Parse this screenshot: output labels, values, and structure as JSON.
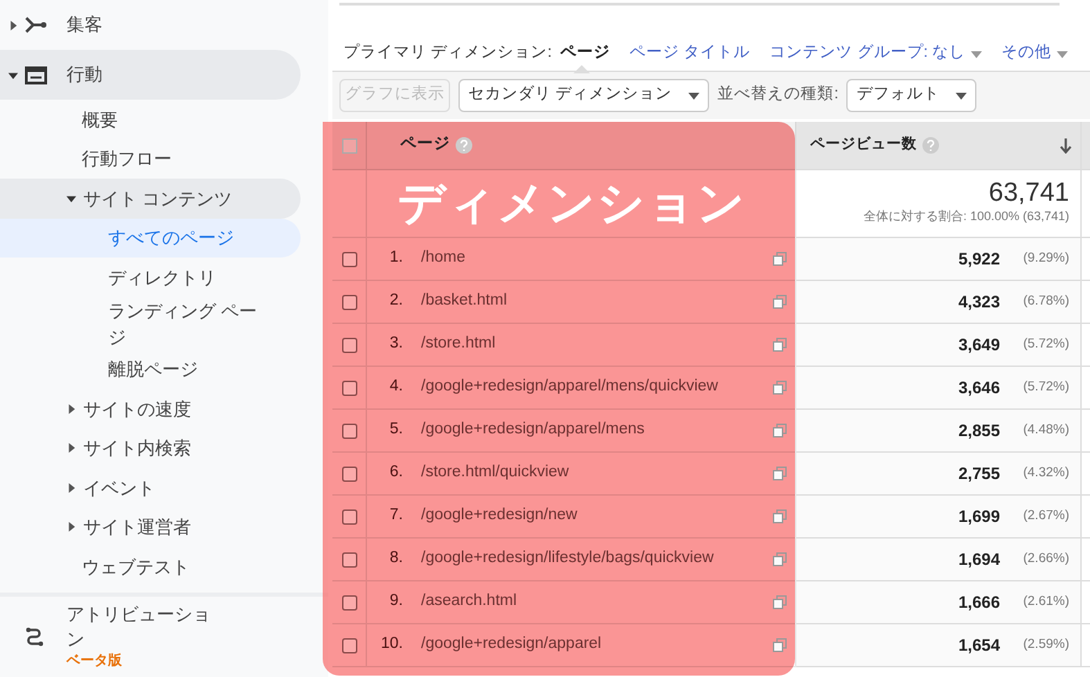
{
  "sidebar": {
    "items": [
      {
        "label": "集客",
        "expanded": false
      },
      {
        "label": "行動",
        "expanded": true,
        "children": [
          {
            "label": "概要"
          },
          {
            "label": "行動フロー"
          },
          {
            "label": "サイト コンテンツ",
            "expanded": true,
            "children": [
              {
                "label": "すべてのページ",
                "selected": true
              },
              {
                "label": "ディレクトリ",
                "selected": false
              },
              {
                "label": "ランディング ページ",
                "selected": false
              },
              {
                "label": "離脱ページ",
                "selected": false
              }
            ]
          },
          {
            "label": "サイトの速度",
            "expanded": false
          },
          {
            "label": "サイト内検索",
            "expanded": false
          },
          {
            "label": "イベント",
            "expanded": false
          },
          {
            "label": "サイト運営者",
            "expanded": false
          },
          {
            "label": "ウェブテスト"
          }
        ]
      },
      {
        "label": "アトリビューション",
        "badge": "ベータ版"
      }
    ]
  },
  "dimension_bar": {
    "label": "プライマリ ディメンション:",
    "tabs": [
      {
        "label": "ページ",
        "selected": true,
        "dropdown": false
      },
      {
        "label": "ページ タイトル",
        "selected": false,
        "dropdown": false
      },
      {
        "label": "コンテンツ グループ: なし",
        "selected": false,
        "dropdown": true
      },
      {
        "label": "その他",
        "selected": false,
        "dropdown": true
      }
    ]
  },
  "toolbar": {
    "chart_button": {
      "label": "グラフに表示",
      "disabled": true
    },
    "secondary_dimension": "セカンダリ ディメンション",
    "sort_label": "並べ替えの種類:",
    "sort_value": "デフォルト"
  },
  "table": {
    "select_all_checked": false,
    "columns": [
      {
        "label": "ページ",
        "help": true,
        "sorted": false
      },
      {
        "label": "ページビュー数",
        "help": true,
        "sorted": true
      }
    ],
    "total": {
      "value": "63,741",
      "share": "全体に対する割合: 100.00% (63,741)"
    },
    "rows": [
      {
        "index": "1.",
        "page": "/home",
        "views": "5,922",
        "percent": "(9.29%)",
        "checked": false
      },
      {
        "index": "2.",
        "page": "/basket.html",
        "views": "4,323",
        "percent": "(6.78%)",
        "checked": false
      },
      {
        "index": "3.",
        "page": "/store.html",
        "views": "3,649",
        "percent": "(5.72%)",
        "checked": false
      },
      {
        "index": "4.",
        "page": "/google+redesign/apparel/mens/quickview",
        "views": "3,646",
        "percent": "(5.72%)",
        "checked": false
      },
      {
        "index": "5.",
        "page": "/google+redesign/apparel/mens",
        "views": "2,855",
        "percent": "(4.48%)",
        "checked": false
      },
      {
        "index": "6.",
        "page": "/store.html/quickview",
        "views": "2,755",
        "percent": "(4.32%)",
        "checked": false
      },
      {
        "index": "7.",
        "page": "/google+redesign/new",
        "views": "1,699",
        "percent": "(2.67%)",
        "checked": false
      },
      {
        "index": "8.",
        "page": "/google+redesign/lifestyle/bags/quickview",
        "views": "1,694",
        "percent": "(2.66%)",
        "checked": false
      },
      {
        "index": "9.",
        "page": "/asearch.html",
        "views": "1,666",
        "percent": "(2.61%)",
        "checked": false
      },
      {
        "index": "10.",
        "page": "/google+redesign/apparel",
        "views": "1,654",
        "percent": "(2.59%)",
        "checked": false
      }
    ]
  },
  "overlay": {
    "label": "ディメンション"
  }
}
